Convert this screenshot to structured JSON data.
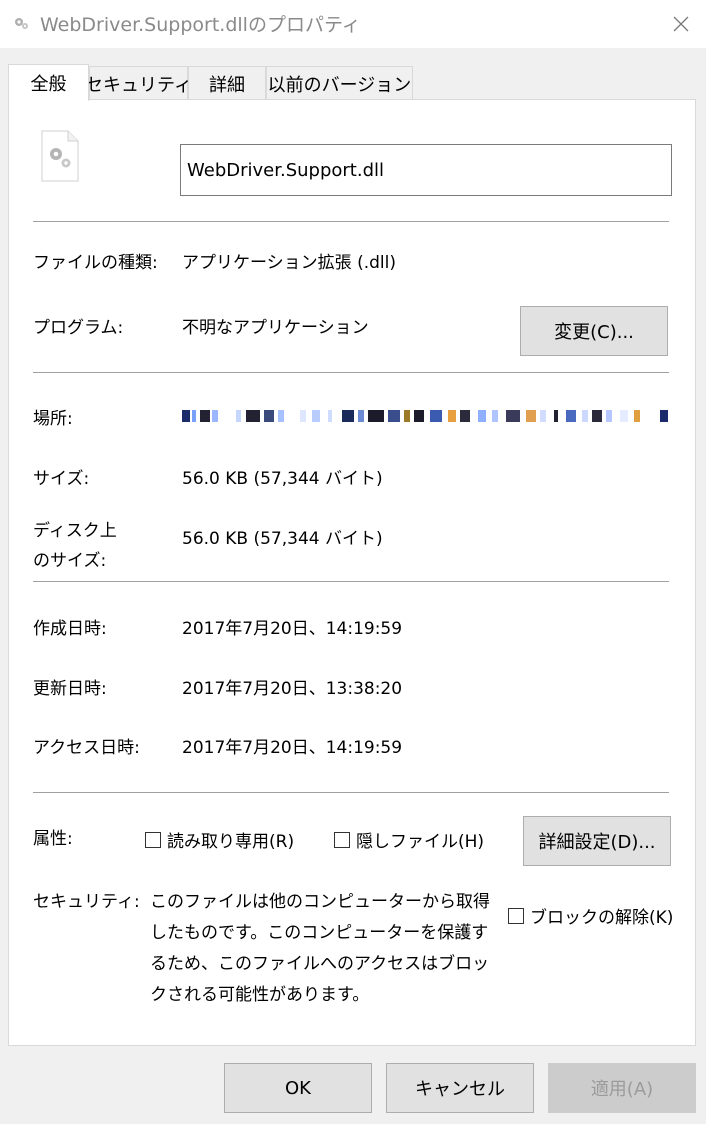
{
  "window": {
    "title": "WebDriver.Support.dllのプロパティ",
    "close_icon": "close-icon"
  },
  "tabs": [
    {
      "label": "全般",
      "active": true
    },
    {
      "label": "セキュリティ"
    },
    {
      "label": "詳細"
    },
    {
      "label": "以前のバージョン"
    }
  ],
  "general": {
    "file_name": "WebDriver.Support.dll",
    "file_type": {
      "label": "ファイルの種類:",
      "value": "アプリケーション拡張 (.dll)"
    },
    "program": {
      "label": "プログラム:",
      "value": "不明なアプリケーション",
      "change_button": "変更(C)..."
    },
    "location": {
      "label": "場所:",
      "value_obscured": true
    },
    "size": {
      "label": "サイズ:",
      "value": "56.0 KB (57,344 バイト)"
    },
    "size_on_disk": {
      "label_line1": "ディスク上",
      "label_line2": "のサイズ:",
      "value": "56.0 KB (57,344 バイト)"
    },
    "created": {
      "label": "作成日時:",
      "value": "2017年7月20日、14:19:59"
    },
    "modified": {
      "label": "更新日時:",
      "value": "2017年7月20日、13:38:20"
    },
    "accessed": {
      "label": "アクセス日時:",
      "value": "2017年7月20日、14:19:59"
    },
    "attributes": {
      "label": "属性:",
      "readonly_label": "読み取り専用(R)",
      "readonly_checked": false,
      "hidden_label": "隠しファイル(H)",
      "hidden_checked": false,
      "advanced_button": "詳細設定(D)..."
    },
    "security": {
      "label": "セキュリティ:",
      "message": "このファイルは他のコンピューターから取得したものです。このコンピューターを保護するため、このファイルへのアクセスはブロックされる可能性があります。",
      "unblock_label": "ブロックの解除(K)",
      "unblock_checked": false
    }
  },
  "footer": {
    "ok": "OK",
    "cancel": "キャンセル",
    "apply": "適用(A)",
    "apply_enabled": false
  }
}
